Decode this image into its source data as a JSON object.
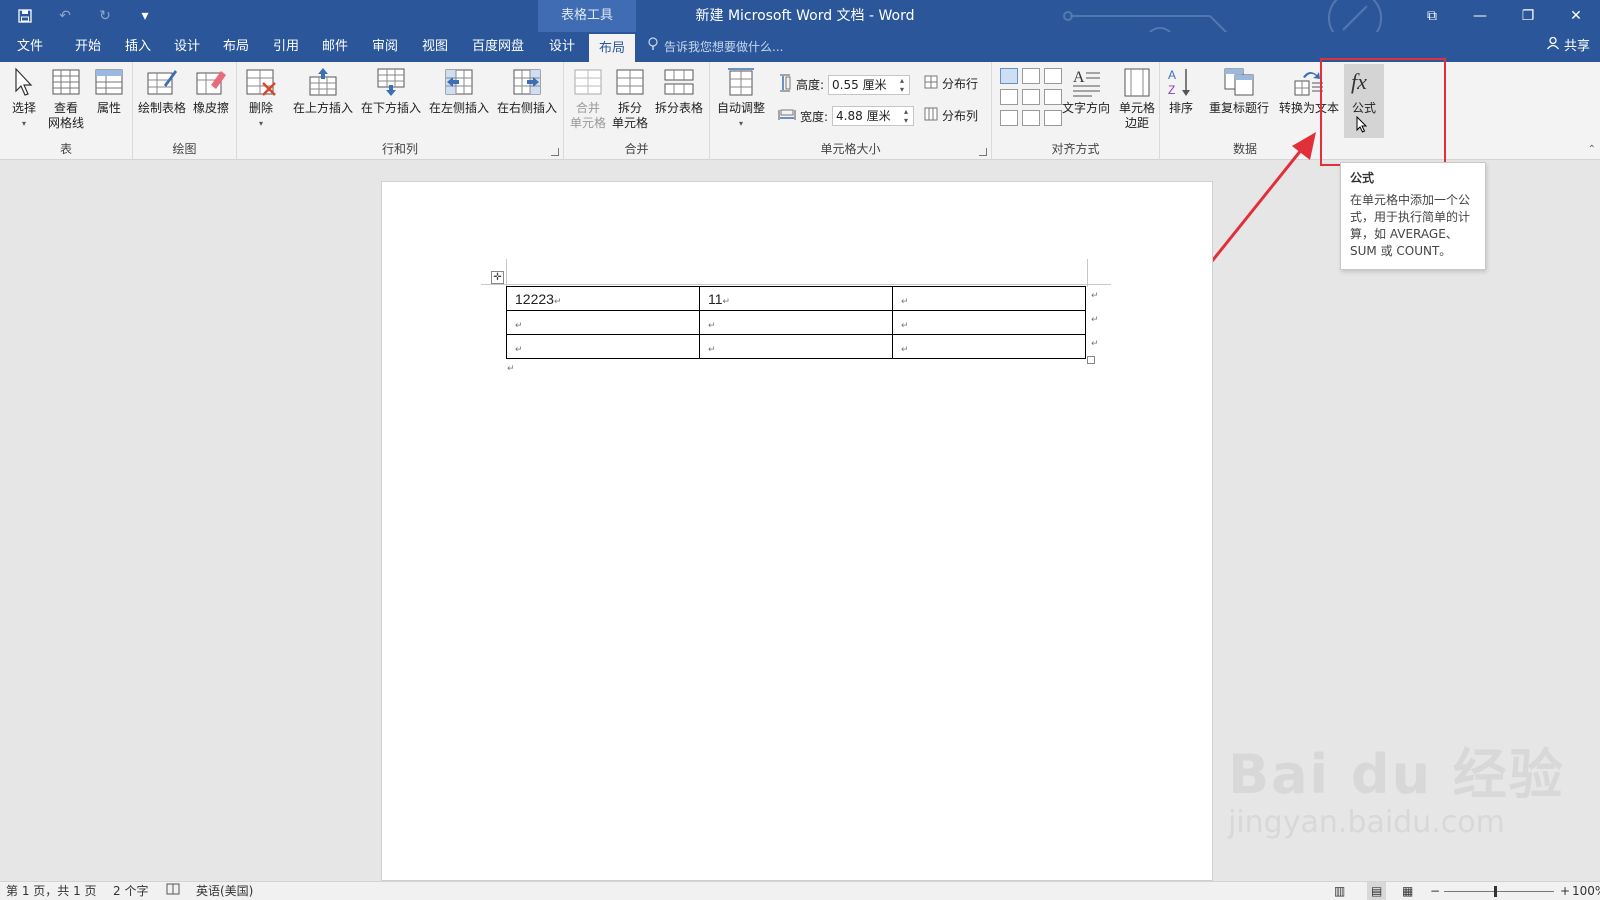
{
  "titlebar": {
    "context_tab": "表格工具",
    "doc_title": "新建 Microsoft Word 文档 - Word"
  },
  "tabs": [
    "文件",
    "开始",
    "插入",
    "设计",
    "布局",
    "引用",
    "邮件",
    "审阅",
    "视图",
    "百度网盘",
    "设计",
    "布局"
  ],
  "tell_me": "告诉我您想要做什么...",
  "share": "共享",
  "ribbon": {
    "table_group": {
      "label": "表",
      "select": "选择",
      "gridlines_1": "查看",
      "gridlines_2": "网格线",
      "properties": "属性"
    },
    "draw_group": {
      "label": "绘图",
      "draw_table": "绘制表格",
      "eraser": "橡皮擦"
    },
    "rows_cols_group": {
      "label": "行和列",
      "delete": "删除",
      "insert_above": "在上方插入",
      "insert_below": "在下方插入",
      "insert_left": "在左侧插入",
      "insert_right": "在右侧插入"
    },
    "merge_group": {
      "label": "合并",
      "merge_1": "合并",
      "merge_2": "单元格",
      "split_1": "拆分",
      "split_2": "单元格",
      "split_table": "拆分表格"
    },
    "cell_size_group": {
      "label": "单元格大小",
      "autofit": "自动调整",
      "height_label": "高度:",
      "height_value": "0.55 厘米",
      "width_label": "宽度:",
      "width_value": "4.88 厘米",
      "distribute_rows": "分布行",
      "distribute_cols": "分布列"
    },
    "alignment_group": {
      "label": "对齐方式",
      "text_direction": "文字方向",
      "margins_1": "单元格",
      "margins_2": "边距"
    },
    "data_group": {
      "label": "数据",
      "sort": "排序",
      "repeat_header": "重复标题行",
      "convert_to_text": "转换为文本",
      "formula": "公式"
    }
  },
  "tooltip": {
    "title": "公式",
    "body": "在单元格中添加一个公式，用于执行简单的计算，如 AVERAGE、SUM 或 COUNT。"
  },
  "table": {
    "rows": [
      [
        "12223",
        "11",
        ""
      ],
      [
        "",
        "",
        ""
      ],
      [
        "",
        "",
        ""
      ]
    ]
  },
  "watermark": {
    "big": "Bai du 经验",
    "small": "jingyan.baidu.com"
  },
  "statusbar": {
    "page": "第 1 页，共 1 页",
    "words": "2 个字",
    "language": "英语(美国)",
    "zoom": "100%"
  }
}
